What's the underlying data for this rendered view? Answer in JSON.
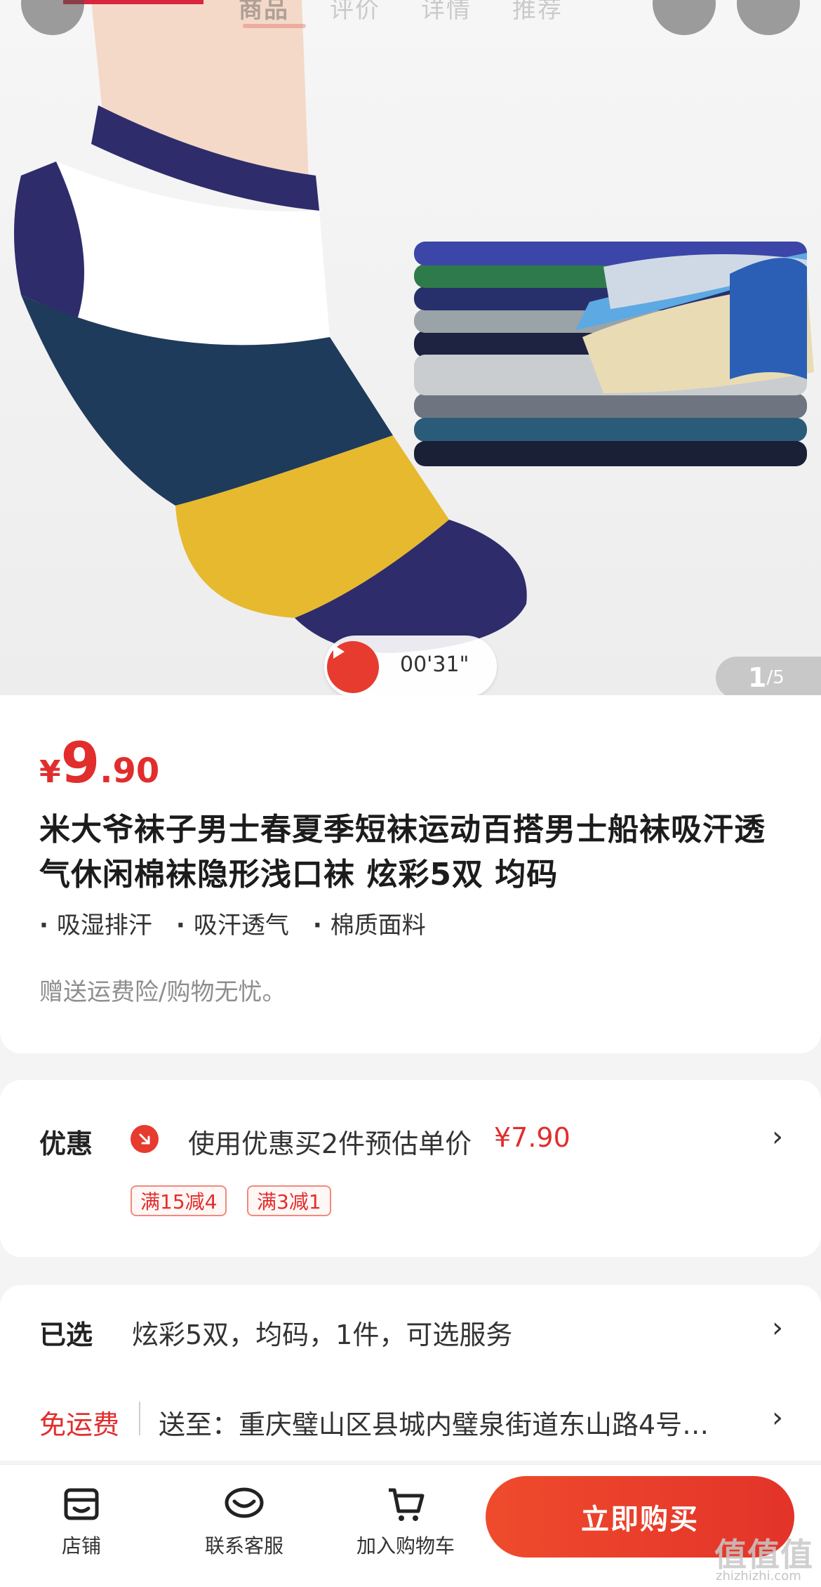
{
  "header": {
    "tabs": [
      "商品",
      "评价",
      "详情",
      "推荐"
    ],
    "active_tab": "商品"
  },
  "hero": {
    "video_time": "00'31\"",
    "pager_current": "1",
    "pager_total": "/5"
  },
  "product": {
    "currency": "¥",
    "price_int": "9",
    "price_dec": ".90",
    "title": "米大爷袜子男士春夏季短袜运动百搭男士船袜吸汗透气休闲棉袜隐形浅口袜 炫彩5双 均码",
    "features": [
      "吸湿排汗",
      "吸汗透气",
      "棉质面料"
    ],
    "gift": "赠送运费险/购物无忧。"
  },
  "promo": {
    "label": "优惠",
    "text": "使用优惠买2件预估单价",
    "price": "¥7.90",
    "chevron": "›",
    "coupons": [
      "满15减4",
      "满3减1"
    ]
  },
  "selection": {
    "label": "已选",
    "value": "炫彩5双，均码，1件，可选服务",
    "chevron": "›"
  },
  "shipping": {
    "label": "免运费",
    "value": "送至：重庆璧山区县城内璧泉街道东山路4号…",
    "chevron": "›"
  },
  "bottom_bar": {
    "shop": "店铺",
    "service": "联系客服",
    "cart": "加入购物车",
    "buy": "立即购买"
  },
  "watermark": {
    "text": "值值值",
    "sub": "zhizhizhi.com"
  },
  "colors": {
    "accent_red": "#e22d2d",
    "buy_button": "#e63b2e"
  }
}
